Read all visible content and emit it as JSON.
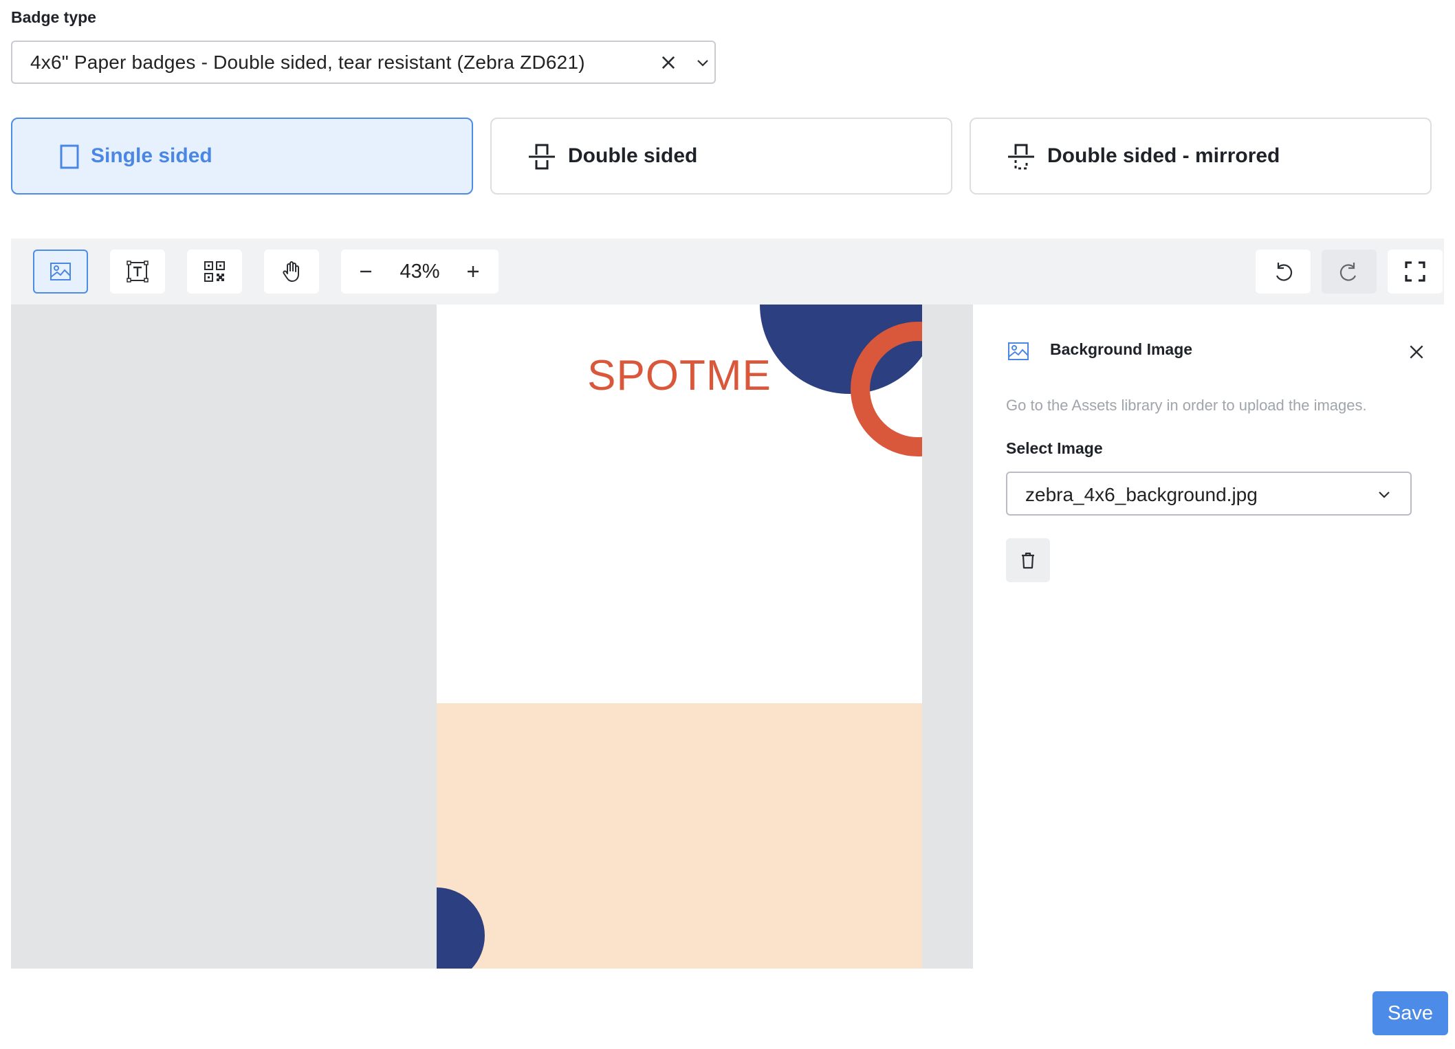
{
  "badge_type": {
    "label": "Badge type",
    "value": "4x6\" Paper badges - Double sided, tear resistant (Zebra ZD621)"
  },
  "sides": [
    {
      "label": "Single sided",
      "active": true,
      "icon": "single-page-icon"
    },
    {
      "label": "Double sided",
      "active": false,
      "icon": "double-page-icon"
    },
    {
      "label": "Double sided - mirrored",
      "active": false,
      "icon": "mirrored-page-icon"
    }
  ],
  "toolbar": {
    "tools": [
      "image-tool-icon",
      "text-tool-icon",
      "qr-code-icon",
      "hand-pan-icon"
    ],
    "zoom": "43%",
    "actions": [
      "undo-icon",
      "redo-icon",
      "fullscreen-icon"
    ]
  },
  "badge": {
    "logo": "SPOTME",
    "colors": {
      "navy": "#2c3f80",
      "orange": "#d9583c",
      "peach": "#fae2cb"
    }
  },
  "panel": {
    "title": "Background Image",
    "hint": "Go to the Assets library in order to upload the images.",
    "select_label": "Select Image",
    "select_value": "zebra_4x6_background.jpg"
  },
  "save_label": "Save",
  "colors": {
    "accent": "#4c8be8",
    "accent_bg": "#e7f0fd"
  }
}
